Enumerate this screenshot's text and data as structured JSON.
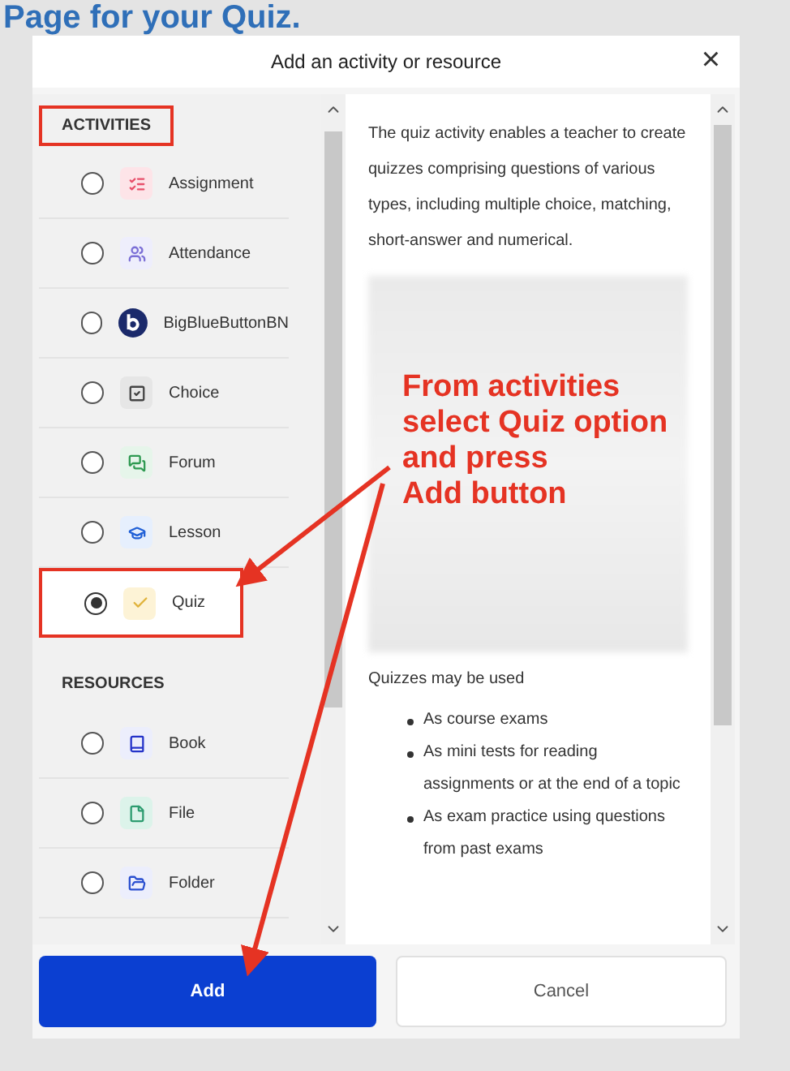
{
  "page_heading": "Page for your Quiz.",
  "dialog": {
    "title": "Add an activity or resource",
    "close": "×"
  },
  "sections": [
    {
      "heading": "ACTIVITIES",
      "highlighted": true,
      "items": [
        {
          "label": "Assignment",
          "selected": false,
          "highlighted": false
        },
        {
          "label": "Attendance",
          "selected": false,
          "highlighted": false
        },
        {
          "label": "BigBlueButtonBN",
          "selected": false,
          "highlighted": false
        },
        {
          "label": "Choice",
          "selected": false,
          "highlighted": false
        },
        {
          "label": "Forum",
          "selected": false,
          "highlighted": false
        },
        {
          "label": "Lesson",
          "selected": false,
          "highlighted": false
        },
        {
          "label": "Quiz",
          "selected": true,
          "highlighted": true
        }
      ]
    },
    {
      "heading": "RESOURCES",
      "highlighted": false,
      "items": [
        {
          "label": "Book",
          "selected": false,
          "highlighted": false
        },
        {
          "label": "File",
          "selected": false,
          "highlighted": false
        },
        {
          "label": "Folder",
          "selected": false,
          "highlighted": false
        }
      ]
    }
  ],
  "description": {
    "intro": "The quiz activity enables a teacher to create quizzes comprising questions of various types, including multiple choice, matching, short-answer and numerical.",
    "uses_heading": "Quizzes may be used",
    "uses": [
      "As course exams",
      "As mini tests for reading assignments or at the end of a topic",
      "As exam practice using questions from past exams"
    ]
  },
  "buttons": {
    "add": "Add",
    "cancel": "Cancel"
  },
  "annotation": {
    "callout_lines": [
      "From activities",
      "select Quiz option",
      "and press",
      "Add button"
    ]
  }
}
